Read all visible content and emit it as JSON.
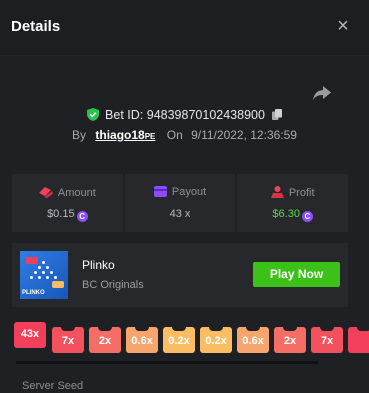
{
  "header": {
    "title": "Details",
    "close_symbol": "×"
  },
  "bet": {
    "id_label": "Bet ID:",
    "id_value": "94839870102438900",
    "by_label": "By",
    "username": "thiago18",
    "username_suffix": "PE",
    "on_label": "On",
    "datetime": "9/11/2022, 12:36:59"
  },
  "stats": {
    "amount": {
      "label": "Amount",
      "value": "$0.15"
    },
    "payout": {
      "label": "Payout",
      "value": "43 x"
    },
    "profit": {
      "label": "Profit",
      "value": "$6.30"
    }
  },
  "game": {
    "name": "Plinko",
    "provider": "BC Originals",
    "thumb_text": "PLINKO",
    "play_label": "Play Now"
  },
  "multipliers": [
    {
      "label": "43x",
      "color": "#f2405a"
    },
    {
      "label": "7x",
      "color": "#f4515f"
    },
    {
      "label": "2x",
      "color": "#f56e66"
    },
    {
      "label": "0.6x",
      "color": "#f7a56e"
    },
    {
      "label": "0.2x",
      "color": "#fbbd63"
    },
    {
      "label": "0.2x",
      "color": "#fbbd63"
    },
    {
      "label": "0.6x",
      "color": "#f7a56e"
    },
    {
      "label": "2x",
      "color": "#f56e66"
    },
    {
      "label": "7x",
      "color": "#f4515f"
    },
    {
      "label": "",
      "color": "#f2405a"
    }
  ],
  "seed": {
    "label": "Server Seed"
  },
  "colors": {
    "accent_green": "#3bc117",
    "profit_green": "#5fd94c",
    "coin_purple": "#8b4dff",
    "shield_green": "#27c64a"
  },
  "icons": {
    "close": "close-icon",
    "share": "share-icon",
    "shield": "shield-check-icon",
    "copy": "copy-icon",
    "amount": "amount-icon",
    "payout": "payout-card-icon",
    "profit": "profit-icon",
    "coin": "coin-icon"
  }
}
